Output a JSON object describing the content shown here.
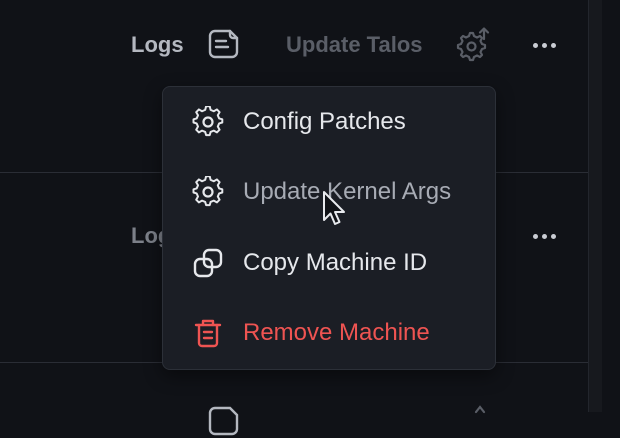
{
  "rows": [
    {
      "logs_label": "Logs",
      "update_label": "Update Talos"
    },
    {
      "logs_label": "Logs"
    }
  ],
  "menu": {
    "items": [
      {
        "label": "Config Patches",
        "icon": "gear-icon"
      },
      {
        "label": "Update Kernel Args",
        "icon": "gear-icon"
      },
      {
        "label": "Copy Machine ID",
        "icon": "copy-icon"
      },
      {
        "label": "Remove Machine",
        "icon": "trash-icon"
      }
    ]
  },
  "colors": {
    "background": "#101217",
    "menu_background": "#1b1e25",
    "text": "#e6e8ec",
    "muted_text": "#6f737c",
    "danger": "#ef5452"
  }
}
